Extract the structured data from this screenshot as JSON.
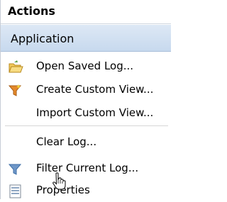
{
  "pane": {
    "title": "Actions",
    "section": "Application",
    "items": [
      {
        "label": "Open Saved Log...",
        "icon": "folder-open-icon"
      },
      {
        "label": "Create Custom View...",
        "icon": "filter-icon"
      },
      {
        "label": "Import Custom View...",
        "icon": ""
      },
      {
        "label": "Clear Log...",
        "icon": ""
      },
      {
        "label": "Filter Current Log...",
        "icon": "filter-icon"
      },
      {
        "label": "Properties",
        "icon": "properties-icon"
      }
    ]
  },
  "colors": {
    "section_bg": "#c7d9ee",
    "folder_yellow": "#e9b43a",
    "filter_orange": "#e48a2b",
    "filter_blue": "#3d6ea6"
  }
}
